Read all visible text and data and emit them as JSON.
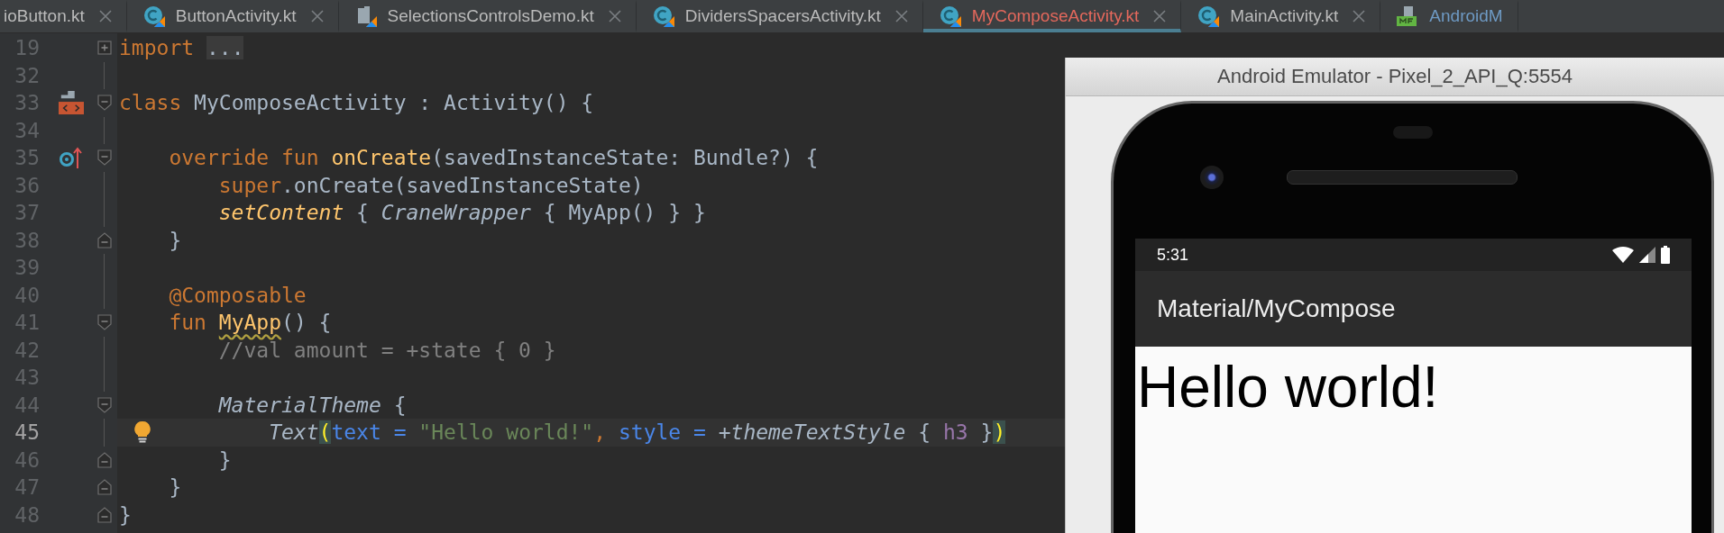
{
  "tabs": [
    {
      "label": "ioButton.kt",
      "kind": "cut",
      "selected": false
    },
    {
      "label": "ButtonActivity.kt",
      "kind": "class",
      "selected": false
    },
    {
      "label": "SelectionsControlsDemo.kt",
      "kind": "file",
      "selected": false
    },
    {
      "label": "DividersSpacersActivity.kt",
      "kind": "class",
      "selected": false
    },
    {
      "label": "MyComposeActivity.kt",
      "kind": "class",
      "selected": true
    },
    {
      "label": "MainActivity.kt",
      "kind": "class",
      "selected": false
    },
    {
      "label": "AndroidM",
      "kind": "manifest",
      "selected": false
    }
  ],
  "editor": {
    "lines": [
      {
        "number": "19",
        "current": false,
        "tokens": [
          {
            "text": "import ",
            "kind": "keyword"
          },
          {
            "text": "...",
            "kind": "folded"
          }
        ]
      },
      {
        "number": "32",
        "current": false
      },
      {
        "number": "33",
        "current": false,
        "tokens": [
          {
            "text": "class ",
            "kind": "keyword"
          },
          {
            "text": "MyComposeActivity : Activity() {",
            "kind": "plain"
          }
        ]
      },
      {
        "number": "34",
        "current": false
      },
      {
        "number": "35",
        "current": false,
        "tokens": [
          {
            "text": "    override fun ",
            "kind": "keyword"
          },
          {
            "text": "onCreate",
            "kind": "function"
          },
          {
            "text": "(savedInstanceState: Bundle?) {",
            "kind": "plain"
          }
        ]
      },
      {
        "number": "36",
        "current": false,
        "tokens": [
          {
            "text": "        super",
            "kind": "keyword"
          },
          {
            "text": ".onCreate(savedInstanceState)",
            "kind": "plain"
          }
        ]
      },
      {
        "number": "37",
        "current": false,
        "tokens": [
          {
            "text": "        setContent",
            "kind": "extension"
          },
          {
            "text": " { ",
            "kind": "plain"
          },
          {
            "text": "CraneWrapper",
            "kind": "call"
          },
          {
            "text": " { MyApp() } }",
            "kind": "plain"
          }
        ]
      },
      {
        "number": "38",
        "current": false,
        "tokens": [
          {
            "text": "    }",
            "kind": "plain"
          }
        ]
      },
      {
        "number": "39",
        "current": false
      },
      {
        "number": "40",
        "current": false,
        "tokens": [
          {
            "text": "    @Composable",
            "kind": "annotation"
          }
        ]
      },
      {
        "number": "41",
        "current": false,
        "tokens": [
          {
            "text": "    fun ",
            "kind": "keyword"
          },
          {
            "text": "MyApp",
            "kind": "warning"
          },
          {
            "text": "() {",
            "kind": "plain"
          }
        ]
      },
      {
        "number": "42",
        "current": false,
        "tokens": [
          {
            "text": "        //val amount = +state { 0 }",
            "kind": "comment"
          }
        ]
      },
      {
        "number": "43",
        "current": false
      },
      {
        "number": "44",
        "current": false,
        "tokens": [
          {
            "text": "        MaterialTheme",
            "kind": "call"
          },
          {
            "text": " {",
            "kind": "plain"
          }
        ]
      },
      {
        "number": "45",
        "current": true,
        "tokens": [
          {
            "text": "            Text",
            "kind": "call"
          },
          {
            "text": "(",
            "kind": "bracket"
          },
          {
            "text": "text = ",
            "kind": "param"
          },
          {
            "text": "\"Hello world!\"",
            "kind": "string"
          },
          {
            "text": ", ",
            "kind": "keyword"
          },
          {
            "text": "style = ",
            "kind": "param"
          },
          {
            "text": "+",
            "kind": "plain"
          },
          {
            "text": "themeTextStyle",
            "kind": "call"
          },
          {
            "text": " { ",
            "kind": "plain"
          },
          {
            "text": "h3",
            "kind": "named"
          },
          {
            "text": " }",
            "kind": "plain"
          },
          {
            "text": ")",
            "kind": "bracket"
          }
        ]
      },
      {
        "number": "46",
        "current": false,
        "tokens": [
          {
            "text": "        }",
            "kind": "plain"
          }
        ]
      },
      {
        "number": "47",
        "current": false,
        "tokens": [
          {
            "text": "    }",
            "kind": "plain"
          }
        ]
      },
      {
        "number": "48",
        "current": false,
        "tokens": [
          {
            "text": "}",
            "kind": "plain"
          }
        ]
      }
    ]
  },
  "emulator": {
    "title": "Android Emulator - Pixel_2_API_Q:5554",
    "phone": {
      "time": "5:31",
      "app_bar_title": "Material/MyCompose",
      "content_text": "Hello world!"
    }
  }
}
